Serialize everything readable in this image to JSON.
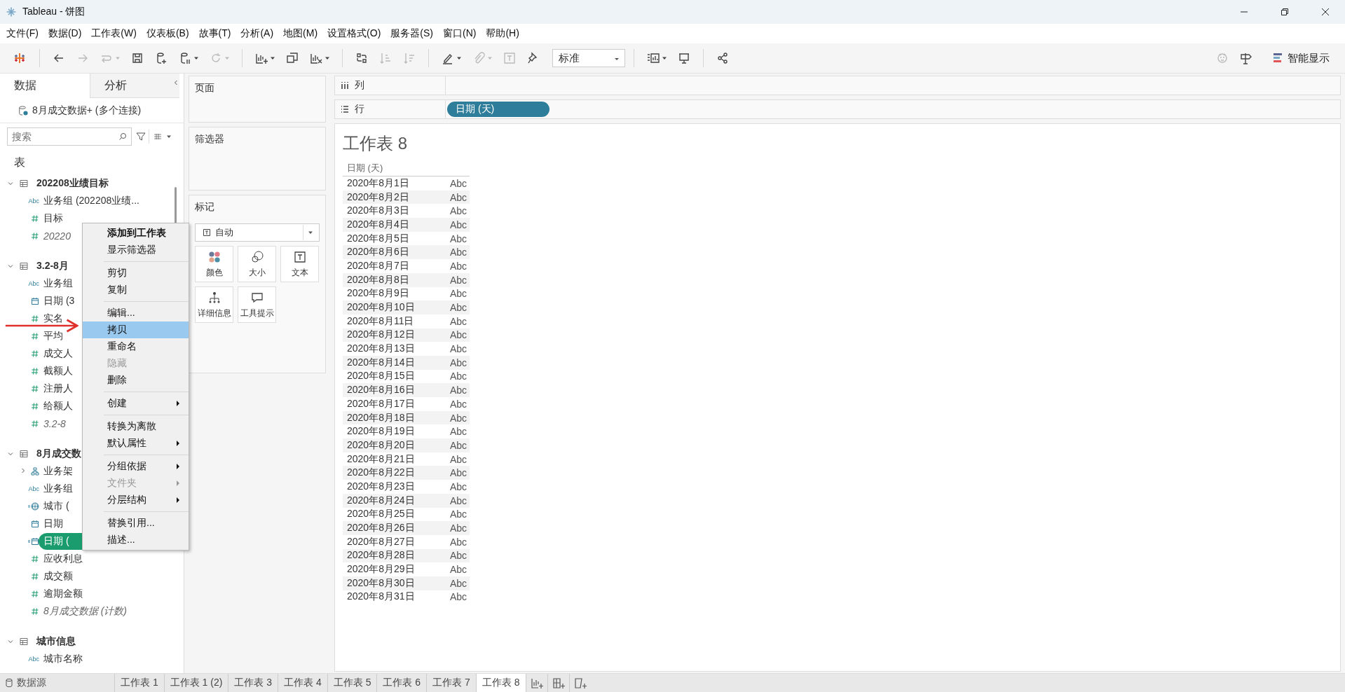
{
  "window": {
    "title": "Tableau - 饼图"
  },
  "menu": [
    "文件(F)",
    "数据(D)",
    "工作表(W)",
    "仪表板(B)",
    "故事(T)",
    "分析(A)",
    "地图(M)",
    "设置格式(O)",
    "服务器(S)",
    "窗口(N)",
    "帮助(H)"
  ],
  "toolbar": [
    {
      "kind": "logo"
    },
    {
      "kind": "separator"
    },
    {
      "kind": "back",
      "disabled": false,
      "dropdown": false
    },
    {
      "kind": "forward",
      "disabled": true,
      "dropdown": false
    },
    {
      "kind": "loop",
      "disabled": true,
      "dropdown": true
    },
    {
      "kind": "save",
      "disabled": false,
      "dropdown": false
    },
    {
      "kind": "add-source",
      "disabled": false,
      "dropdown": false
    },
    {
      "kind": "pause-source",
      "disabled": false,
      "dropdown": true
    },
    {
      "kind": "refresh",
      "disabled": true,
      "dropdown": true
    },
    {
      "kind": "separator"
    },
    {
      "kind": "new-sheet",
      "disabled": false,
      "dropdown": true
    },
    {
      "kind": "duplicate",
      "disabled": false,
      "dropdown": false
    },
    {
      "kind": "clear",
      "disabled": false,
      "dropdown": true
    },
    {
      "kind": "separator"
    },
    {
      "kind": "swap",
      "disabled": false,
      "dropdown": false
    },
    {
      "kind": "sort-asc",
      "disabled": true,
      "dropdown": false
    },
    {
      "kind": "sort-desc",
      "disabled": true,
      "dropdown": false
    },
    {
      "kind": "separator"
    },
    {
      "kind": "highlight",
      "disabled": false,
      "dropdown": true
    },
    {
      "kind": "clip",
      "disabled": true,
      "dropdown": true
    },
    {
      "kind": "label",
      "disabled": true,
      "dropdown": false
    },
    {
      "kind": "pin",
      "disabled": false,
      "dropdown": false
    },
    {
      "kind": "view-select",
      "value": "标准"
    },
    {
      "kind": "separator"
    },
    {
      "kind": "cards",
      "disabled": false,
      "dropdown": true
    },
    {
      "kind": "present",
      "disabled": false,
      "dropdown": false
    },
    {
      "kind": "separator"
    },
    {
      "kind": "share",
      "disabled": false,
      "dropdown": false
    }
  ],
  "toolbar_right": [
    {
      "kind": "bot",
      "disabled": true
    },
    {
      "kind": "signpost",
      "disabled": false
    }
  ],
  "show_me": {
    "label": "智能显示"
  },
  "side_tabs": [
    {
      "label": "数据",
      "selected": true
    },
    {
      "label": "分析",
      "selected": false
    }
  ],
  "connection": "8月成交数据+ (多个连接)",
  "search": {
    "placeholder": "搜索"
  },
  "tables_heading": "表",
  "tables": [
    {
      "name": "202208业绩目标",
      "expanded": true,
      "fields": [
        {
          "kind": "string",
          "badge": "Abc",
          "name": "业务组 (202208业绩...",
          "selected": false,
          "generated": false
        },
        {
          "kind": "measure",
          "name": "目标",
          "selected": false,
          "generated": false
        },
        {
          "kind": "measure",
          "name": "20220",
          "selected": false,
          "generated": true
        }
      ]
    },
    {
      "name": "3.2-8月",
      "expanded": true,
      "fields": [
        {
          "kind": "string",
          "badge": "Abc",
          "name": "业务组",
          "selected": false,
          "generated": false
        },
        {
          "kind": "date",
          "name": "日期 (3",
          "selected": false,
          "generated": false
        },
        {
          "kind": "measure",
          "name": "实名",
          "selected": false,
          "generated": false
        },
        {
          "kind": "measure",
          "name": "平均",
          "selected": false,
          "generated": false
        },
        {
          "kind": "measure",
          "name": "成交人",
          "selected": false,
          "generated": false
        },
        {
          "kind": "measure",
          "name": "截额人",
          "selected": false,
          "generated": false
        },
        {
          "kind": "measure",
          "name": "注册人",
          "selected": false,
          "generated": false
        },
        {
          "kind": "measure",
          "name": "给额人",
          "selected": false,
          "generated": false
        },
        {
          "kind": "measure",
          "name": "3.2-8",
          "selected": false,
          "generated": true
        }
      ]
    },
    {
      "name": "8月成交数",
      "expanded": true,
      "fields": [
        {
          "kind": "hierarchy",
          "name": "业务架",
          "selected": false,
          "generated": false,
          "expanded": false
        },
        {
          "kind": "string",
          "badge": "Abc",
          "name": "业务组",
          "selected": false,
          "generated": false
        },
        {
          "kind": "geo-link",
          "name": "城市 (",
          "selected": false,
          "generated": false
        },
        {
          "kind": "date",
          "name": "日期",
          "selected": false,
          "generated": false
        },
        {
          "kind": "date-link",
          "name": "日期 (",
          "selected": true,
          "generated": false
        },
        {
          "kind": "measure",
          "name": "应收利息",
          "selected": false,
          "generated": false
        },
        {
          "kind": "measure",
          "name": "成交额",
          "selected": false,
          "generated": false
        },
        {
          "kind": "measure",
          "name": "逾期金额",
          "selected": false,
          "generated": false
        },
        {
          "kind": "measure",
          "name": "8月成交数据 (计数)",
          "selected": false,
          "generated": true
        }
      ]
    },
    {
      "name": "城市信息",
      "expanded": true,
      "fields": [
        {
          "kind": "string",
          "badge": "Abc",
          "name": "城市名称",
          "selected": false,
          "generated": false
        }
      ]
    }
  ],
  "pages_shelf": {
    "label": "页面"
  },
  "filters_shelf": {
    "label": "筛选器"
  },
  "marks": {
    "label": "标记",
    "type": "自动",
    "cards": [
      {
        "kind": "color",
        "label": "颜色"
      },
      {
        "kind": "size",
        "label": "大小"
      },
      {
        "kind": "text",
        "label": "文本"
      },
      {
        "kind": "detail",
        "label": "详细信息"
      },
      {
        "kind": "tooltip",
        "label": "工具提示"
      }
    ]
  },
  "columns_shelf": {
    "label": "列"
  },
  "rows_shelf": {
    "label": "行",
    "pills": [
      {
        "label": "日期 (天)"
      }
    ]
  },
  "sheet": {
    "title": "工作表 8",
    "header": "日期 (天)",
    "rows": [
      {
        "date": "2020年8月1日",
        "value": "Abc"
      },
      {
        "date": "2020年8月2日",
        "value": "Abc"
      },
      {
        "date": "2020年8月3日",
        "value": "Abc"
      },
      {
        "date": "2020年8月4日",
        "value": "Abc"
      },
      {
        "date": "2020年8月5日",
        "value": "Abc"
      },
      {
        "date": "2020年8月6日",
        "value": "Abc"
      },
      {
        "date": "2020年8月7日",
        "value": "Abc"
      },
      {
        "date": "2020年8月8日",
        "value": "Abc"
      },
      {
        "date": "2020年8月9日",
        "value": "Abc"
      },
      {
        "date": "2020年8月10日",
        "value": "Abc"
      },
      {
        "date": "2020年8月11日",
        "value": "Abc"
      },
      {
        "date": "2020年8月12日",
        "value": "Abc"
      },
      {
        "date": "2020年8月13日",
        "value": "Abc"
      },
      {
        "date": "2020年8月14日",
        "value": "Abc"
      },
      {
        "date": "2020年8月15日",
        "value": "Abc"
      },
      {
        "date": "2020年8月16日",
        "value": "Abc"
      },
      {
        "date": "2020年8月17日",
        "value": "Abc"
      },
      {
        "date": "2020年8月18日",
        "value": "Abc"
      },
      {
        "date": "2020年8月19日",
        "value": "Abc"
      },
      {
        "date": "2020年8月20日",
        "value": "Abc"
      },
      {
        "date": "2020年8月21日",
        "value": "Abc"
      },
      {
        "date": "2020年8月22日",
        "value": "Abc"
      },
      {
        "date": "2020年8月23日",
        "value": "Abc"
      },
      {
        "date": "2020年8月24日",
        "value": "Abc"
      },
      {
        "date": "2020年8月25日",
        "value": "Abc"
      },
      {
        "date": "2020年8月26日",
        "value": "Abc"
      },
      {
        "date": "2020年8月27日",
        "value": "Abc"
      },
      {
        "date": "2020年8月28日",
        "value": "Abc"
      },
      {
        "date": "2020年8月29日",
        "value": "Abc"
      },
      {
        "date": "2020年8月30日",
        "value": "Abc"
      },
      {
        "date": "2020年8月31日",
        "value": "Abc"
      }
    ]
  },
  "context_menu": [
    {
      "kind": "item",
      "label": "添加到工作表",
      "default": true,
      "selected": false,
      "disabled": false,
      "submenu": false
    },
    {
      "kind": "item",
      "label": "显示筛选器",
      "default": false,
      "selected": false,
      "disabled": false,
      "submenu": false
    },
    {
      "kind": "separator"
    },
    {
      "kind": "item",
      "label": "剪切",
      "default": false,
      "selected": false,
      "disabled": false,
      "submenu": false
    },
    {
      "kind": "item",
      "label": "复制",
      "default": false,
      "selected": false,
      "disabled": false,
      "submenu": false
    },
    {
      "kind": "separator"
    },
    {
      "kind": "item",
      "label": "编辑...",
      "default": false,
      "selected": false,
      "disabled": false,
      "submenu": false
    },
    {
      "kind": "item",
      "label": "拷贝",
      "default": false,
      "selected": true,
      "disabled": false,
      "submenu": false
    },
    {
      "kind": "item",
      "label": "重命名",
      "default": false,
      "selected": false,
      "disabled": false,
      "submenu": false
    },
    {
      "kind": "item",
      "label": "隐藏",
      "default": false,
      "selected": false,
      "disabled": true,
      "submenu": false
    },
    {
      "kind": "item",
      "label": "删除",
      "default": false,
      "selected": false,
      "disabled": false,
      "submenu": false
    },
    {
      "kind": "separator"
    },
    {
      "kind": "item",
      "label": "创建",
      "default": false,
      "selected": false,
      "disabled": false,
      "submenu": true
    },
    {
      "kind": "separator"
    },
    {
      "kind": "item",
      "label": "转换为离散",
      "default": false,
      "selected": false,
      "disabled": false,
      "submenu": false
    },
    {
      "kind": "item",
      "label": "默认属性",
      "default": false,
      "selected": false,
      "disabled": false,
      "submenu": true
    },
    {
      "kind": "separator"
    },
    {
      "kind": "item",
      "label": "分组依据",
      "default": false,
      "selected": false,
      "disabled": false,
      "submenu": true
    },
    {
      "kind": "item",
      "label": "文件夹",
      "default": false,
      "selected": false,
      "disabled": true,
      "submenu": true
    },
    {
      "kind": "item",
      "label": "分层结构",
      "default": false,
      "selected": false,
      "disabled": false,
      "submenu": true
    },
    {
      "kind": "separator"
    },
    {
      "kind": "item",
      "label": "替换引用...",
      "default": false,
      "selected": false,
      "disabled": false,
      "submenu": false
    },
    {
      "kind": "item",
      "label": "描述...",
      "default": false,
      "selected": false,
      "disabled": false,
      "submenu": false
    }
  ],
  "datasource_tab": {
    "label": "数据源"
  },
  "sheet_tabs": [
    {
      "label": "工作表 1",
      "selected": false
    },
    {
      "label": "工作表 1 (2)",
      "selected": false
    },
    {
      "label": "工作表 3",
      "selected": false
    },
    {
      "label": "工作表 4",
      "selected": false
    },
    {
      "label": "工作表 5",
      "selected": false
    },
    {
      "label": "工作表 6",
      "selected": false
    },
    {
      "label": "工作表 7",
      "selected": false
    },
    {
      "label": "工作表 8",
      "selected": true
    }
  ],
  "new_tab_buttons": [
    {
      "kind": "worksheet"
    },
    {
      "kind": "dashboard"
    },
    {
      "kind": "story"
    }
  ]
}
